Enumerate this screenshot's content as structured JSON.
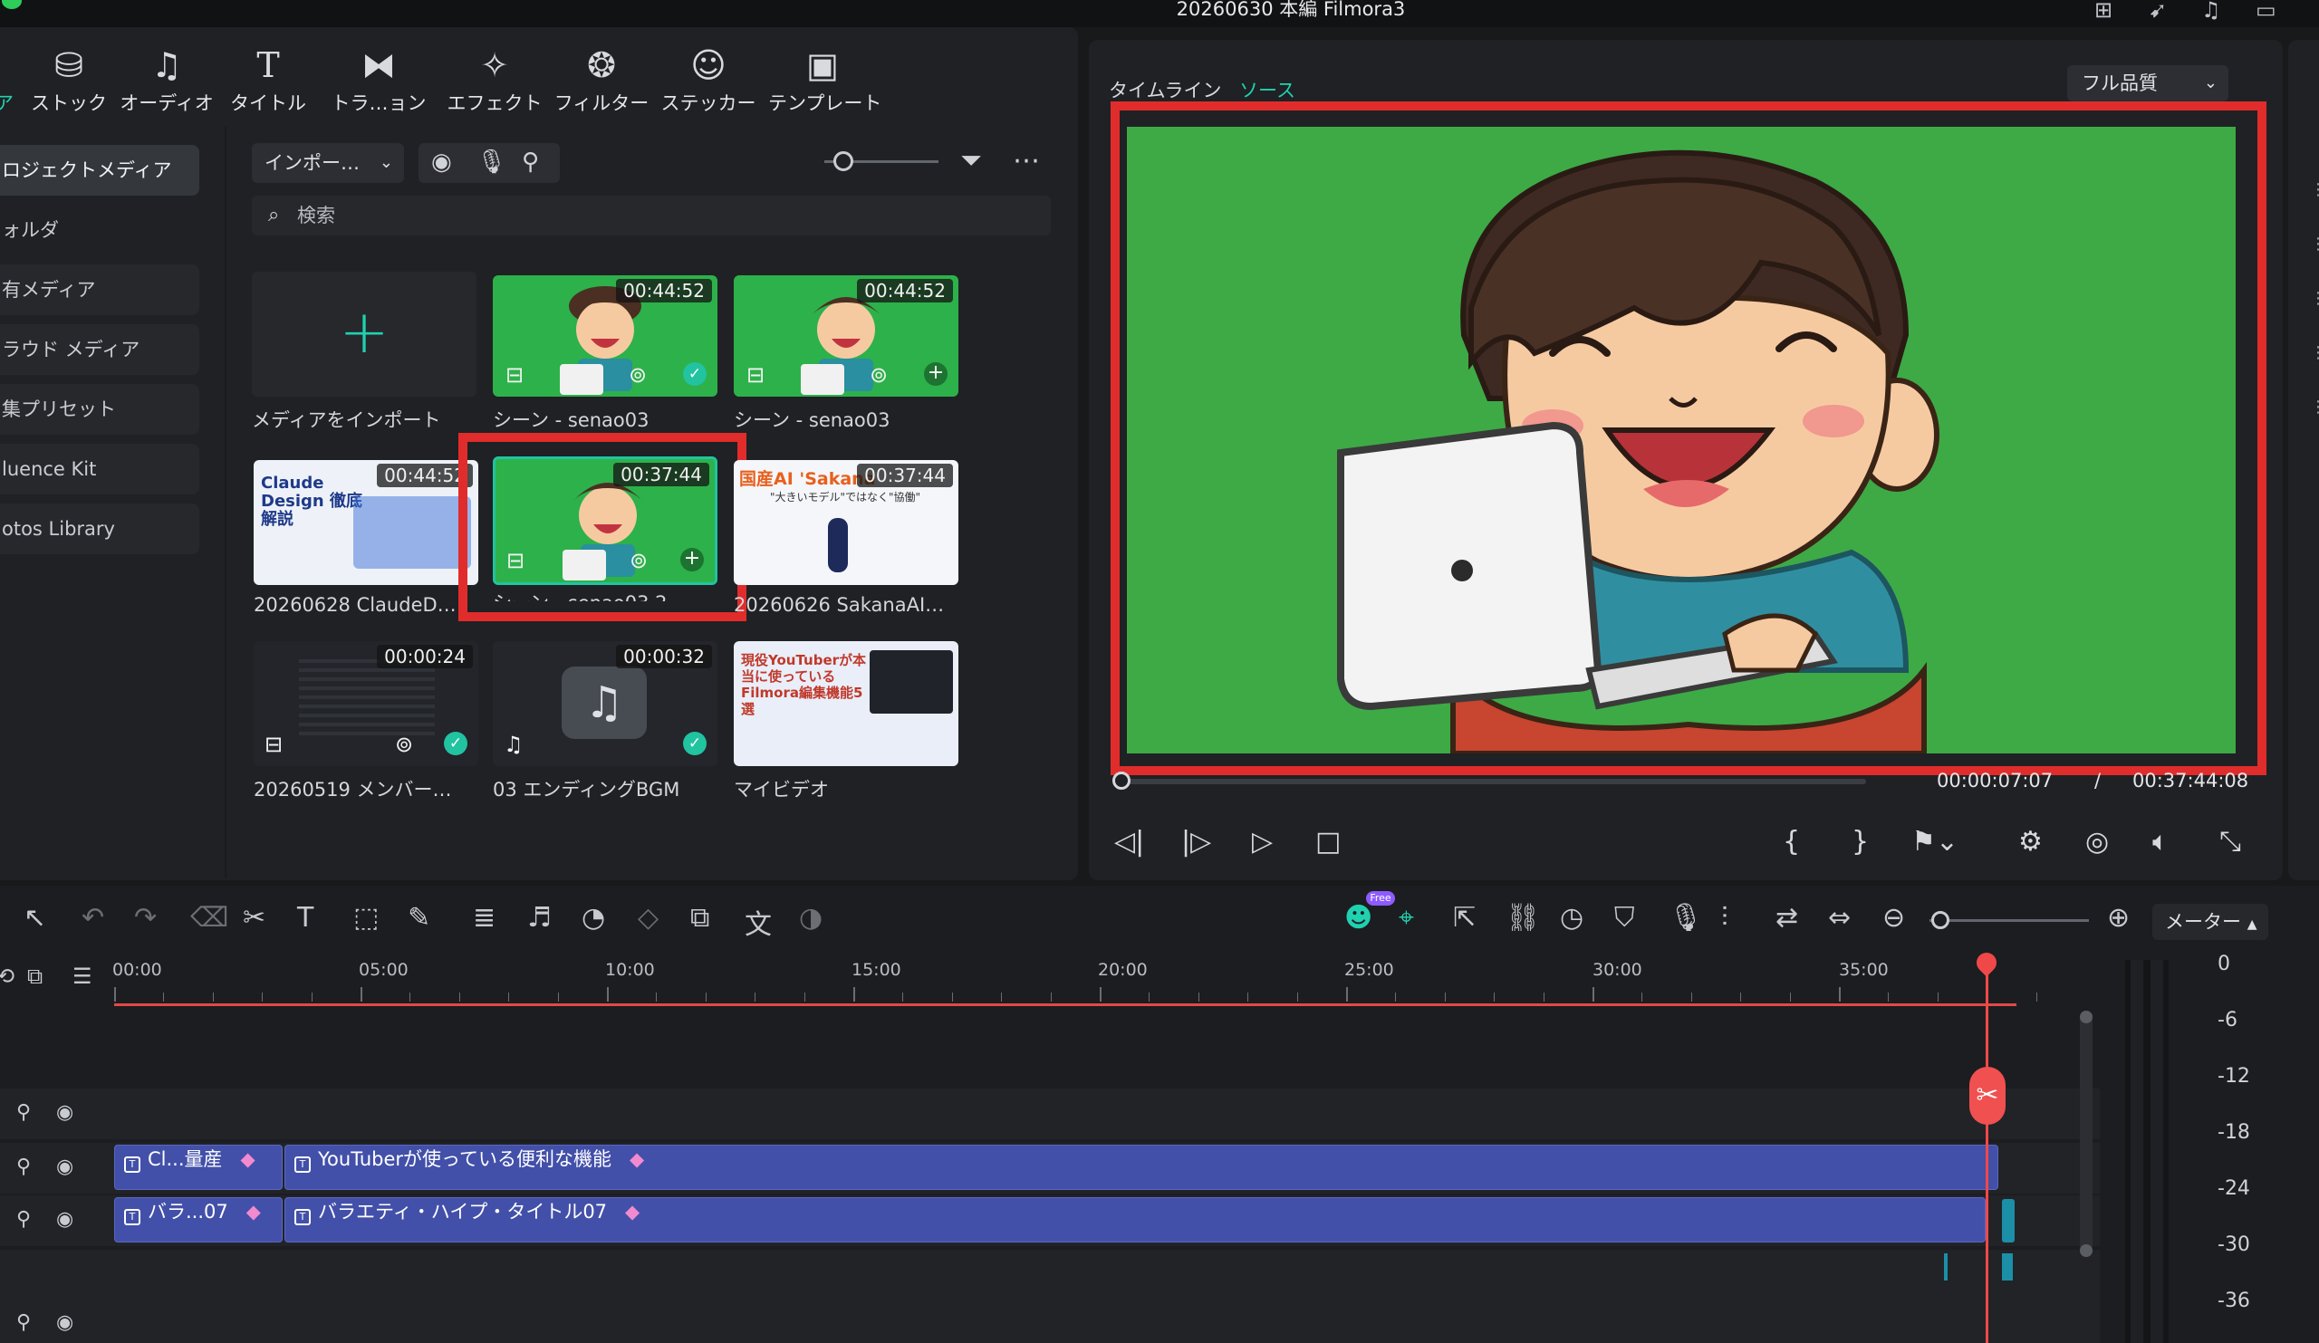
{
  "window": {
    "title": "20260630 本編 Filmora3"
  },
  "toolbar_tabs": [
    "ストック",
    "オーディオ",
    "タイトル",
    "トラ…ョン",
    "エフェクト",
    "フィルター",
    "ステッカー",
    "テンプレート"
  ],
  "toolbar_tabs_cut": "ア",
  "sidebar": {
    "items": [
      "ロジェクトメディア",
      "ォルダ",
      "有メディア",
      "ラウド メディア",
      "集プリセット",
      "luence Kit",
      "otos Library"
    ]
  },
  "media": {
    "import_dropdown": "インポー…",
    "search_placeholder": "検索",
    "items": [
      {
        "name": "メディアをインポート",
        "duration": ""
      },
      {
        "name": "シーン - senao03",
        "duration": "00:44:52"
      },
      {
        "name": "シーン - senao03",
        "duration": "00:44:52"
      },
      {
        "name": "20260628 ClaudeD…",
        "duration": "00:44:52",
        "thumb_title": "Claude Design 徹底解説"
      },
      {
        "name": "シーン - senao03 2",
        "duration": "00:37:44"
      },
      {
        "name": "20260626 SakanaAI…",
        "duration": "00:37:44",
        "thumb_title": "国産AI 'Sakana",
        "thumb_sub": "\"大きいモデル\"ではなく\"協働\""
      },
      {
        "name": "20260519 メンバー…",
        "duration": "00:00:24"
      },
      {
        "name": "03 エンディングBGM",
        "duration": "00:00:32"
      },
      {
        "name": "マイビデオ",
        "duration": "",
        "thumb_title": "現役YouTuberが本当に使っているFilmora編集機能5選"
      }
    ]
  },
  "preview": {
    "tab_timeline": "タイムライン",
    "tab_source": "ソース",
    "quality": "フル品質",
    "current_time": "00:00:07:07",
    "separator": "/",
    "total_time": "00:37:44:08",
    "playhead_fraction": 0.003
  },
  "timeline": {
    "free_badge": "Free",
    "meter_label": "メーター",
    "ruler_labels": [
      "00:00",
      "05:00",
      "10:00",
      "15:00",
      "20:00",
      "25:00",
      "30:00",
      "35:00"
    ],
    "tracks": [
      {
        "clips": [
          {
            "label": "Cl...量産"
          },
          {
            "label": "YouTuberが使っている便利な機能"
          }
        ]
      },
      {
        "clips": [
          {
            "label": "バラ...07"
          },
          {
            "label": "バラエティ・ハイプ・タイトル07"
          }
        ]
      }
    ],
    "meter_scale": [
      "0",
      "-6",
      "-12",
      "-18",
      "-24",
      "-30",
      "-36"
    ]
  },
  "colors": {
    "accent": "#21c3a0",
    "highlight": "#e12c2c",
    "clip": "#4350a9",
    "playhead": "#f04848",
    "preview_bg": "#3daa46"
  }
}
